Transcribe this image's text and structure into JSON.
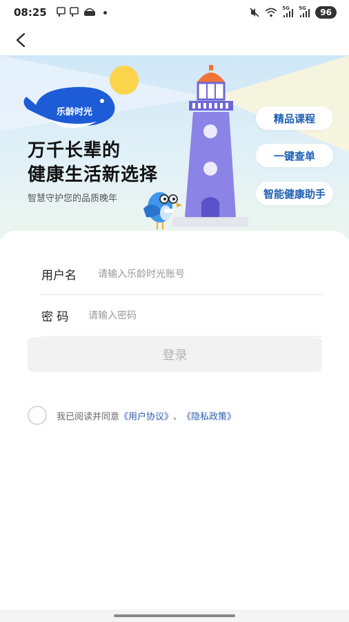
{
  "status_bar": {
    "time": "08:25",
    "signal_1_label": "5G",
    "signal_2_label": "5G",
    "battery": "96",
    "icons": [
      "notification-icon",
      "notification-icon",
      "app-icon",
      "mute-icon",
      "wifi-icon",
      "signal-icon",
      "signal-icon"
    ]
  },
  "nav": {
    "back_icon": "chevron-left-icon"
  },
  "banner": {
    "logo_text": "乐龄时光",
    "headline_line1": "万千长辈的",
    "headline_line2": "健康生活新选择",
    "tagline": "智慧守护您的品质晚年",
    "buttons": [
      "精品课程",
      "一键查单",
      "智能健康助手"
    ],
    "colors": {
      "sky": "#cfe7f7",
      "lighthouse": "#8c83e6",
      "sun": "#fbd44a",
      "whale": "#1e5bd6",
      "accent_text": "#1f5fb4"
    }
  },
  "form": {
    "username_label": "用户名",
    "username_placeholder": "请输入乐龄时光账号",
    "password_label": "密 码",
    "password_placeholder": "请输入密码",
    "login_label": "登录"
  },
  "agreement": {
    "prefix": "我已阅读并同意",
    "user_agreement": "《用户协议》",
    "separator": "、",
    "privacy_policy": "《隐私政策》"
  }
}
